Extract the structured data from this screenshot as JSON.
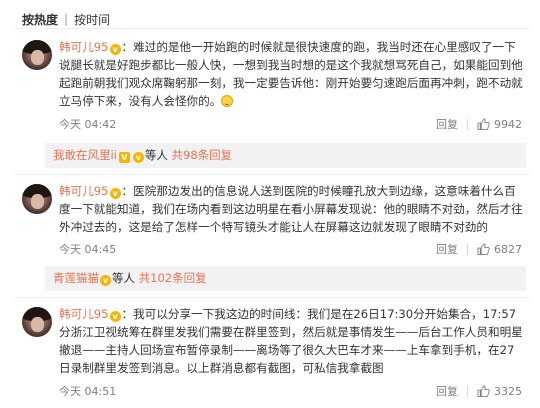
{
  "tabs": {
    "hot": "按热度",
    "time": "按时间"
  },
  "comments": [
    {
      "user": "韩可儿95",
      "text_a": "：难过的是他一开始跑的时候就是很快速度的跑，我当时还在心里感叹了一下说腿长就是好跑步都比一般人快，一想到我当时想的是这个我就想骂死自己，如果能回到他起跑前朝我们观众席鞠躬那一刻，我一定要告诉他：刚开始要匀速跑后面再冲刺，跑不动就立马停下来，没有人会怪你的。",
      "emoji": "crying-face-icon",
      "time": "今天 04:42",
      "reply_label": "回复",
      "likes": "9942",
      "sub": {
        "user": "我敢在风里ii",
        "badge": "V",
        "mid": "等人",
        "link": "共98条回复"
      }
    },
    {
      "user": "韩可儿95",
      "text_a": "：医院那边发出的信息说人送到医院的时候瞳孔放大到边缘，这意味着什么百度一下就能知道，我们在场内看到这边明星在看小屏幕发现说：他的眼睛不对劲，然后才往外冲过去的，这是给了怎样一个特写镜头才能让人在屏幕这边就发现了眼睛不对劲的",
      "time": "今天 04:45",
      "reply_label": "回复",
      "likes": "6827",
      "sub": {
        "user": "青莲猫猫",
        "mid": "等人",
        "link": "共102条回复"
      }
    },
    {
      "user": "韩可儿95",
      "text_a": "：我可以分享一下我这边的时间线：我们是在26日17:30分开始集合，17:57分浙江卫视统筹在群里发我们需要在群里签到，然后就是事情发生——后台工作人员和明星撤退——主持人回场宣布暂停录制——离场等了很久大巴车才来——上车拿到手机，在27日录制群里发签到消息。以上群消息都有截图，可私信我拿截图",
      "time": "今天 04:51",
      "reply_label": "回复",
      "likes": "3325"
    }
  ],
  "colors": {
    "username": "#eb7350",
    "meta": "#808080",
    "sub_bg": "#f2f2f5"
  }
}
